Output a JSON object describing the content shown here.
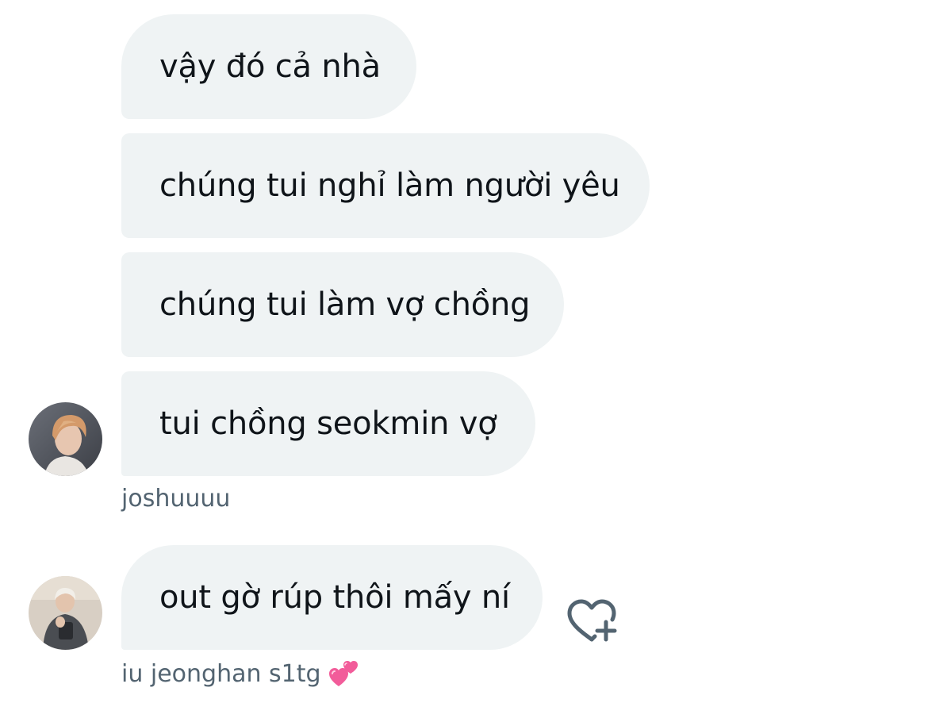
{
  "messages": [
    {
      "text": "vậy đó cả nhà"
    },
    {
      "text": "chúng tui nghỉ làm người yêu"
    },
    {
      "text": "chúng tui làm vợ chồng"
    },
    {
      "text": "tui chồng seokmin vợ"
    },
    {
      "text": "out gờ rúp thôi mấy ní"
    }
  ],
  "senders": [
    {
      "name": "joshuuuu"
    },
    {
      "name": "iu jeonghan s1tg",
      "emoji": "💕"
    }
  ],
  "icons": {
    "reaction": "heart-plus-icon",
    "emoji": "two-hearts-emoji"
  },
  "colors": {
    "bubble_bg": "#eff3f4",
    "text": "#0f1419",
    "secondary_text": "#536471",
    "icon": "#536471",
    "emoji_pink": "#f25c9a"
  }
}
